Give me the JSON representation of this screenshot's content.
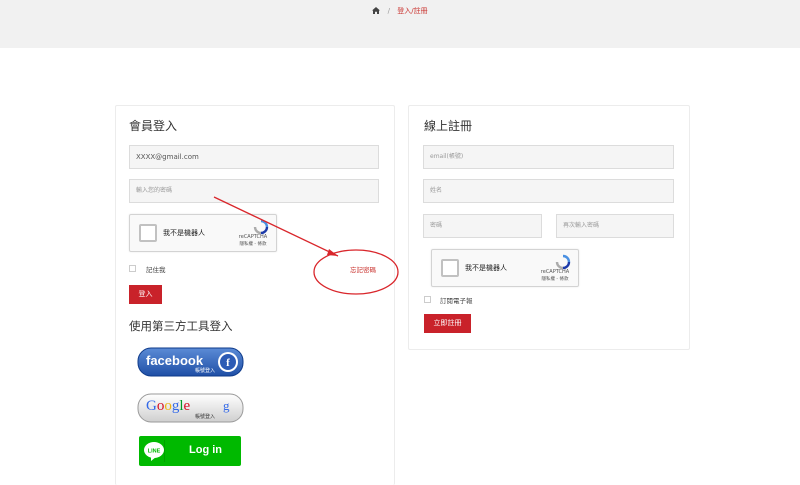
{
  "breadcrumb": {
    "home_icon": "home-icon",
    "separator": "/",
    "current": "登入/註冊"
  },
  "login": {
    "title": "會員登入",
    "email_value": "XXXX@gmail.com",
    "password_placeholder": "輸入您的密碼",
    "captcha": {
      "label": "我不是機器人",
      "brand": "reCAPTCHA",
      "links": "隱私權 - 條款"
    },
    "remember_label": "記住我",
    "forgot_label": "忘記密碼",
    "submit_label": "登入"
  },
  "third_party": {
    "title": "使用第三方工具登入",
    "facebook": {
      "text": "facebook",
      "sub": "帳號登入",
      "color": "#3b5998"
    },
    "google": {
      "text": "Google",
      "suffix": "g",
      "sub": "帳號登入"
    },
    "line": {
      "badge": "LINE",
      "text": "Log in",
      "color": "#00b900"
    }
  },
  "register": {
    "title": "線上註冊",
    "email_placeholder": "email(帳號)",
    "name_placeholder": "姓名",
    "password_placeholder": "密碼",
    "confirm_placeholder": "再次輸入密碼",
    "captcha": {
      "label": "我不是機器人",
      "brand": "reCAPTCHA",
      "links": "隱私權 - 條款"
    },
    "newsletter_label": "訂閱電子報",
    "submit_label": "立即註冊"
  },
  "colors": {
    "accent": "#c9222a",
    "annotation": "#d9262b"
  }
}
